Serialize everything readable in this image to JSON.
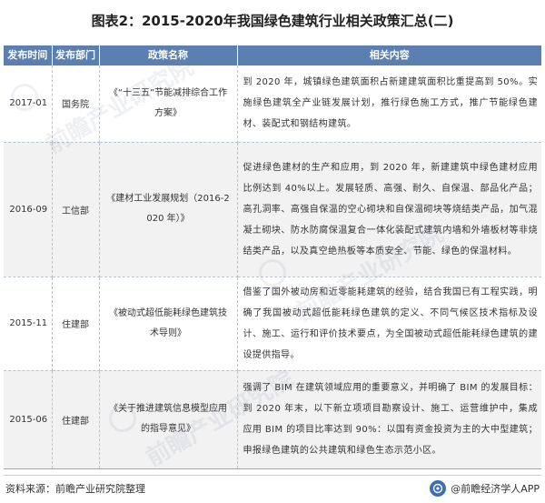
{
  "title": "图表2：2015-2020年我国绿色建筑行业相关政策汇总(二)",
  "table": {
    "headers": [
      "发布时间",
      "发布部门",
      "政策名称",
      "相关内容"
    ],
    "rows": [
      {
        "time": "2017-01",
        "dept": "国务院",
        "name": "《“十三五”节能减排综合工作方案》",
        "content": "到 2020 年，城镇绿色建筑面积占新建建筑面积比重提高到 50%。实施绿色建筑全产业链发展计划，推行绿色施工方式，推广节能绿色建材、装配式和钢结构建筑。"
      },
      {
        "time": "2016-09",
        "dept": "工信部",
        "name": "《建材工业发展规划（2016-2020 年）》",
        "content": "促进绿色建材的生产和应用，到 2020 年，新建建筑中绿色建材应用比例达到 40%以上。发展轻质、高强、耐久、自保温、部品化产品；高孔洞率、高强自保温的空心砌块和自保温砌块等烧结类产品，加气混凝土砌块、防水防腐保温复合一体化装配式建筑内墙和外墙板材等非烧结类产品，以及真空绝热板等本质安全、节能、绿色的保温材料。"
      },
      {
        "time": "2015-11",
        "dept": "住建部",
        "name": "《被动式超低能耗绿色建筑技术导则》",
        "content": "借鉴了国外被动房和近零能耗建筑的经验，结合我国已有工程实践，明确了我国被动式超低能耗绿色建筑的定义、不同气候区技术指标及设计、施工、运行和评价技术要点，为全国被动式超低能耗绿色建筑的建设提供指导。"
      },
      {
        "time": "2015-06",
        "dept": "住建部",
        "name": "《关于推进建筑信息模型应用的指导意见》",
        "content": "强调了 BIM 在建筑领域应用的重要意义，并明确了 BIM 的发展目标：到 2020 年末，以下新立项项目勘察设计、施工、运营维护中，集成应用 BIM 的项目比率达到 90%：以国有资金投资为主的大中型建筑；申报绿色建筑的公共建筑和绿色生态示范小区。"
      }
    ]
  },
  "footer": {
    "source": "资料来源：前瞻产业研究院整理",
    "brand": "@前瞻经济学人APP"
  },
  "watermark_text": "前瞻产业研究院",
  "colors": {
    "header_bg": "#5b7fb0",
    "alt_row_bg": "#f2f2f2",
    "brand_blue": "#3d6fb6"
  }
}
